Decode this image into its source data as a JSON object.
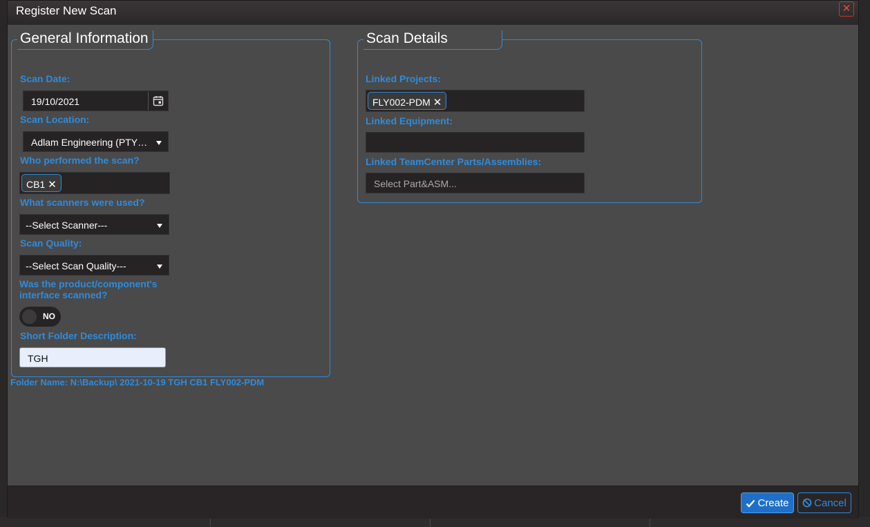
{
  "dialog": {
    "title": "Register New Scan",
    "close_glyph": "✕"
  },
  "general": {
    "legend": "General Information",
    "scan_date_label": "Scan Date:",
    "scan_date_value": "19/10/2021",
    "scan_location_label": "Scan Location:",
    "scan_location_value": "Adlam Engineering (PTY…",
    "performed_by_label": "Who performed the scan?",
    "performed_by_tag": "CB1",
    "scanners_label": "What scanners were used?",
    "scanner_value": "--Select Scanner---",
    "quality_label": "Scan Quality:",
    "quality_value": "--Select Scan Quality---",
    "interface_label_1": "Was the product/component's",
    "interface_label_2": "interface scanned?",
    "interface_toggle": "NO",
    "description_label": "Short Folder Description:",
    "description_value": "TGH"
  },
  "folder_name": "Folder Name: N:\\Backup\\ 2021-10-19 TGH CB1 FLY002-PDM",
  "details": {
    "legend": "Scan Details",
    "projects_label": "Linked Projects:",
    "project_tag": "FLY002-PDM",
    "equipment_label": "Linked Equipment:",
    "parts_label": "Linked TeamCenter Parts/Assemblies:",
    "parts_placeholder": "Select Part&ASM..."
  },
  "tag_remove_glyph": "✕",
  "footer": {
    "create_label": "Create",
    "cancel_label": "Cancel"
  },
  "colors": {
    "accent": "#2f8bdc",
    "panel_bg": "#4a4a4a",
    "field_bg": "#262324",
    "close": "#e74c3c"
  },
  "icons": [
    "calendar-icon",
    "chevron-down-icon",
    "close-icon",
    "check-icon",
    "ban-icon"
  ]
}
